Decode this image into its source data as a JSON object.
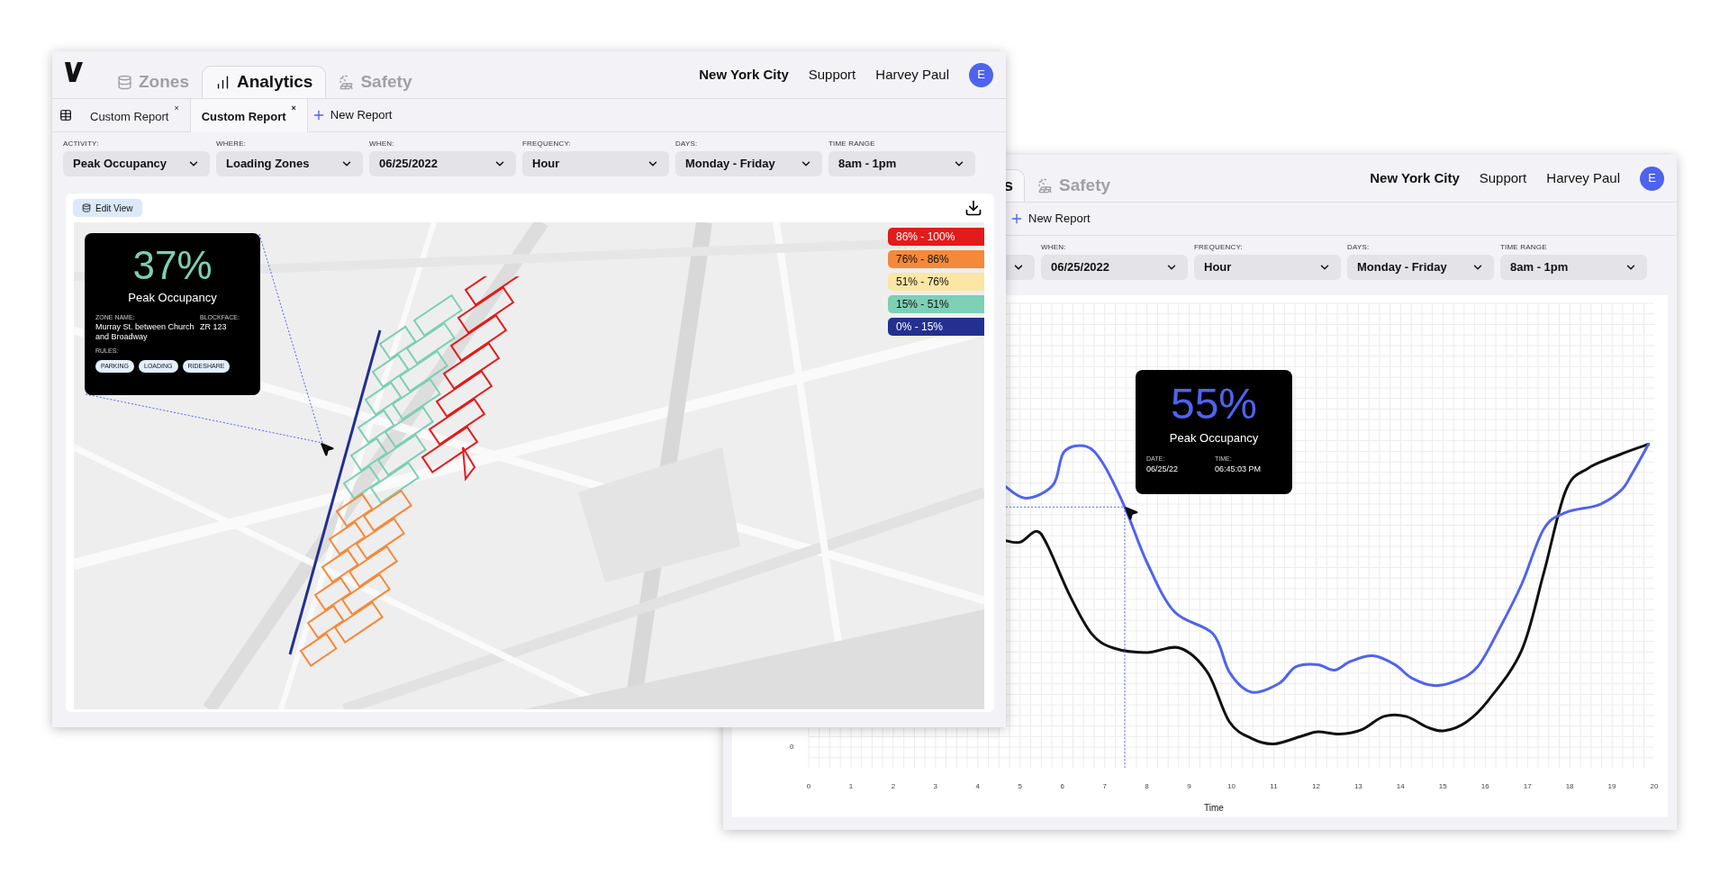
{
  "analytics_window": {
    "nav_tabs": [
      {
        "label": "Zones",
        "selected": false
      },
      {
        "label": "Analytics",
        "selected": true
      },
      {
        "label": "Safety",
        "selected": false
      }
    ],
    "location": "New York City",
    "support": "Support",
    "user": "Harvey Paul",
    "avatar": "E",
    "report_tabs": [
      {
        "label": "Custom Report",
        "close": "×",
        "selected": false
      },
      {
        "label": "Custom Report",
        "close": "×",
        "selected": true
      }
    ],
    "new_report": "New Report",
    "filters": [
      {
        "label": "ACTIVITY:",
        "value": "Peak Occupancy"
      },
      {
        "label": "WHERE:",
        "value": "Loading Zones"
      },
      {
        "label": "WHEN:",
        "value": "06/25/2022"
      },
      {
        "label": "FREQUENCY:",
        "value": "Hour"
      },
      {
        "label": "DAYS:",
        "value": "Monday - Friday"
      },
      {
        "label": "TIME RANGE",
        "value": "8am - 1pm"
      }
    ],
    "edit_view": "Edit View",
    "zone_card": {
      "value": "37%",
      "label": "Peak Occupancy",
      "zone_name_label": "ZONE NAME:",
      "zone_name": "Murray St. between Church and Broadway",
      "blockface_label": "BLOCKFACE:",
      "blockface": "ZR 123",
      "rules_label": "RULES:",
      "rules": [
        "PARKING",
        "LOADING",
        "RIDESHARE"
      ]
    },
    "legend": [
      {
        "label": "86% - 100%",
        "color": "#e31b1b"
      },
      {
        "label": "76% - 86%",
        "color": "#f5893a"
      },
      {
        "label": "51% - 76%",
        "color": "#fbe6a3"
      },
      {
        "label": "15% - 51%",
        "color": "#7dcfb6"
      },
      {
        "label": "0% - 15%",
        "color": "#23308f"
      }
    ]
  },
  "chart_window": {
    "cut_tab": "s",
    "nav_tabs": [
      {
        "label": "Safety",
        "selected": false
      }
    ],
    "location": "New York City",
    "support": "Support",
    "user": "Harvey Paul",
    "avatar": "E",
    "new_report": "New Report",
    "filters": [
      {
        "label": "WHEN:",
        "value": "06/25/2022"
      },
      {
        "label": "FREQUENCY:",
        "value": "Hour"
      },
      {
        "label": "DAYS:",
        "value": "Monday - Friday"
      },
      {
        "label": "TIME RANGE",
        "value": "8am - 1pm"
      }
    ],
    "tooltip": {
      "value": "55%",
      "label": "Peak Occupancy",
      "date_label": "DATE:",
      "date": "06/25/22",
      "time_label": "TIME:",
      "time": "06:45:03 PM"
    },
    "y_tick": "0",
    "x_ticks": [
      "0",
      "1",
      "2",
      "3",
      "4",
      "5",
      "6",
      "7",
      "8",
      "9",
      "10",
      "11",
      "12",
      "13",
      "14",
      "15",
      "16",
      "17",
      "18",
      "19",
      "20"
    ],
    "xlabel": "Time"
  }
}
